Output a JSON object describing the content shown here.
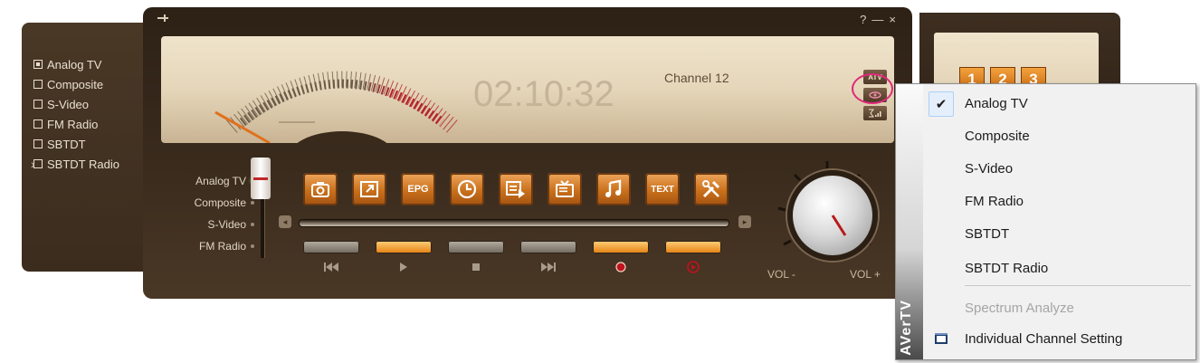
{
  "left_panel": {
    "items": [
      {
        "label": "Analog TV",
        "checked": true
      },
      {
        "label": "Composite",
        "checked": false
      },
      {
        "label": "S-Video",
        "checked": false
      },
      {
        "label": "FM Radio",
        "checked": false
      },
      {
        "label": "SBTDT",
        "checked": false
      },
      {
        "label": "SBTDT Radio",
        "checked": false
      }
    ],
    "arrow": "›"
  },
  "player": {
    "window_controls": {
      "help": "?",
      "minimize": "—",
      "close": "×"
    },
    "display": {
      "time": "02:10:32",
      "channel": "Channel 12",
      "buttons": [
        "ATV",
        "",
        ""
      ]
    },
    "inputs": [
      {
        "label": "Analog TV",
        "active": true
      },
      {
        "label": "Composite",
        "active": false
      },
      {
        "label": "S-Video",
        "active": false
      },
      {
        "label": "FM Radio",
        "active": false
      }
    ],
    "function_buttons": [
      "snapshot-icon",
      "fullscreen-icon",
      "EPG",
      "clock-icon",
      "recording-list-icon",
      "tv-icon",
      "music-icon",
      "TEXT",
      "settings-icon"
    ],
    "epg_label": "EPG",
    "text_label": "TEXT",
    "transport": [
      {
        "name": "previous",
        "active": false
      },
      {
        "name": "play",
        "active": true
      },
      {
        "name": "stop",
        "active": false
      },
      {
        "name": "next",
        "active": false
      },
      {
        "name": "record",
        "active": true
      },
      {
        "name": "timeshift",
        "active": true
      }
    ],
    "volume": {
      "minus_label": "VOL -",
      "plus_label": "VOL +"
    }
  },
  "right_panel": {
    "numbers": [
      "1",
      "2",
      "3"
    ]
  },
  "context_menu": {
    "brand": "AVerTV",
    "items": [
      {
        "label": "Analog TV",
        "checked": true
      },
      {
        "label": "Composite"
      },
      {
        "label": "S-Video"
      },
      {
        "label": "FM Radio"
      },
      {
        "label": "SBTDT"
      },
      {
        "label": "SBTDT Radio"
      },
      {
        "label": "Spectrum Analyze",
        "disabled": true
      },
      {
        "label": "Individual Channel Setting"
      }
    ]
  },
  "colors": {
    "accent_orange": "#d9821f",
    "highlight_ring": "#e0297b",
    "panel_brown": "#3b2c1e"
  }
}
